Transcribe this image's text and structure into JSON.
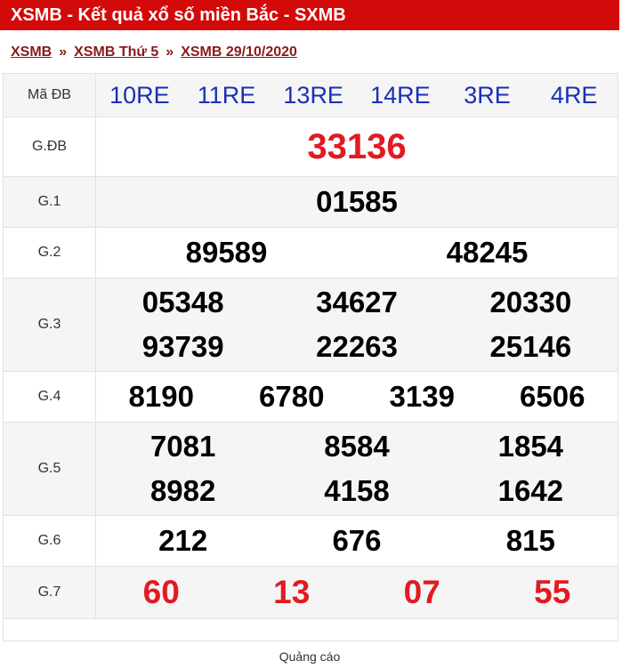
{
  "header": {
    "title": "XSMB - Kết quả xổ số miền Bắc - SXMB"
  },
  "breadcrumb": {
    "items": [
      "XSMB",
      "XSMB Thứ 5",
      "XSMB 29/10/2020"
    ],
    "separator": "»"
  },
  "table": {
    "ma_db": {
      "label": "Mã ĐB",
      "codes": [
        "10RE",
        "11RE",
        "13RE",
        "14RE",
        "3RE",
        "4RE"
      ]
    },
    "g_db": {
      "label": "G.ĐB",
      "numbers": [
        "33136"
      ]
    },
    "g1": {
      "label": "G.1",
      "numbers": [
        "01585"
      ]
    },
    "g2": {
      "label": "G.2",
      "numbers": [
        "89589",
        "48245"
      ]
    },
    "g3": {
      "label": "G.3",
      "numbers": [
        "05348",
        "34627",
        "20330",
        "93739",
        "22263",
        "25146"
      ]
    },
    "g4": {
      "label": "G.4",
      "numbers": [
        "8190",
        "6780",
        "3139",
        "6506"
      ]
    },
    "g5": {
      "label": "G.5",
      "numbers": [
        "7081",
        "8584",
        "1854",
        "8982",
        "4158",
        "1642"
      ]
    },
    "g6": {
      "label": "G.6",
      "numbers": [
        "212",
        "676",
        "815"
      ]
    },
    "g7": {
      "label": "G.7",
      "numbers": [
        "60",
        "13",
        "07",
        "55"
      ]
    }
  },
  "ads": {
    "label": "Quảng cáo"
  },
  "colors": {
    "header_bg": "#d30a0a",
    "code_blue": "#1a2fb8",
    "prize_red": "#e21a22",
    "link": "#8b1a1a"
  }
}
